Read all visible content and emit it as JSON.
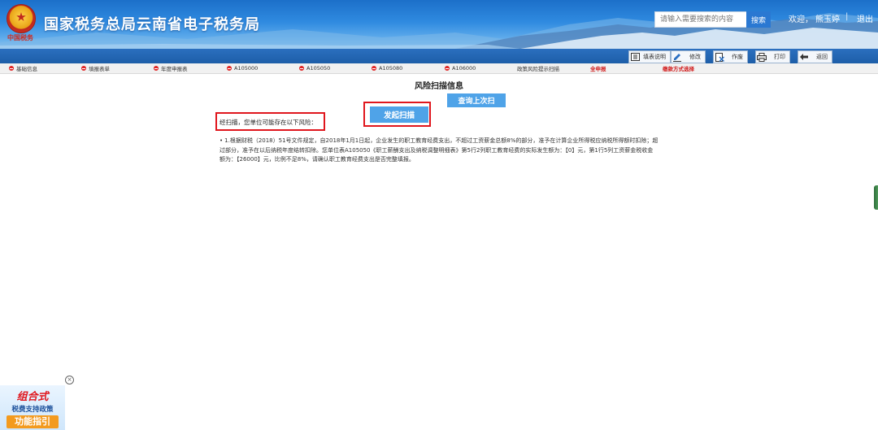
{
  "header": {
    "emblem_caption": "中国税务",
    "title": "国家税务总局云南省电子税务局",
    "search_placeholder": "请输入需要搜索的内容",
    "search_button": "搜索",
    "welcome": "欢迎，",
    "user_name": "熊玉婷",
    "divider": "|",
    "logout": "退出"
  },
  "toolbar": {
    "items": [
      {
        "label": "填表说明",
        "icon": "document-list-icon"
      },
      {
        "label": "修改",
        "icon": "pencil-icon"
      },
      {
        "label": "作废",
        "icon": "void-icon"
      },
      {
        "label": "打印",
        "icon": "printer-icon"
      },
      {
        "label": "返回",
        "icon": "back-arrow-icon"
      }
    ]
  },
  "tabs": [
    {
      "label": "基础信息",
      "has_dot": true
    },
    {
      "label": "填报表单",
      "has_dot": true
    },
    {
      "label": "年度申报表",
      "has_dot": true
    },
    {
      "label": "A105000",
      "has_dot": true
    },
    {
      "label": "A105050",
      "has_dot": true
    },
    {
      "label": "A105080",
      "has_dot": true
    },
    {
      "label": "A106000",
      "has_dot": true
    },
    {
      "label": "政策风险提示扫描",
      "has_dot": false
    },
    {
      "label": "全申报",
      "has_dot": false,
      "highlight": true
    },
    {
      "label": "缴款方式选择",
      "has_dot": false,
      "highlight": true
    }
  ],
  "main": {
    "title": "风险扫描信息",
    "query_button": "查询上次扫",
    "scan_button": "发起扫描",
    "scan_result_label": "经扫描，您单位可能存在以下风险：",
    "risk_items": [
      "1.根据财税（2018）51号文件规定，自2018年1月1日起，企业发生的职工教育经费支出，不超过工资薪金总额8%的部分，准予在计算企业所得税应纳税所得额时扣除；超过部分，准予在以后纳税年度结转扣除。您单位表A105050《职工薪酬支出及纳税调整明细表》第5行2列职工教育经费的实际发生额为：【0】元，第1行5列工资薪金税收金额为：【26000】元，比例不足8%，请确认职工教育经费支出是否完整填报。"
    ]
  },
  "ad_banner": {
    "line1": "组合式",
    "line2": "税费支持政策",
    "line3": "功能指引",
    "close": "×"
  },
  "colors": {
    "header_blue": "#2f8ae0",
    "toolbar_blue": "#1d5ea8",
    "button_blue": "#4fa3e8",
    "highlight_red": "#e0161d",
    "tab_dot_red": "#e02424"
  }
}
